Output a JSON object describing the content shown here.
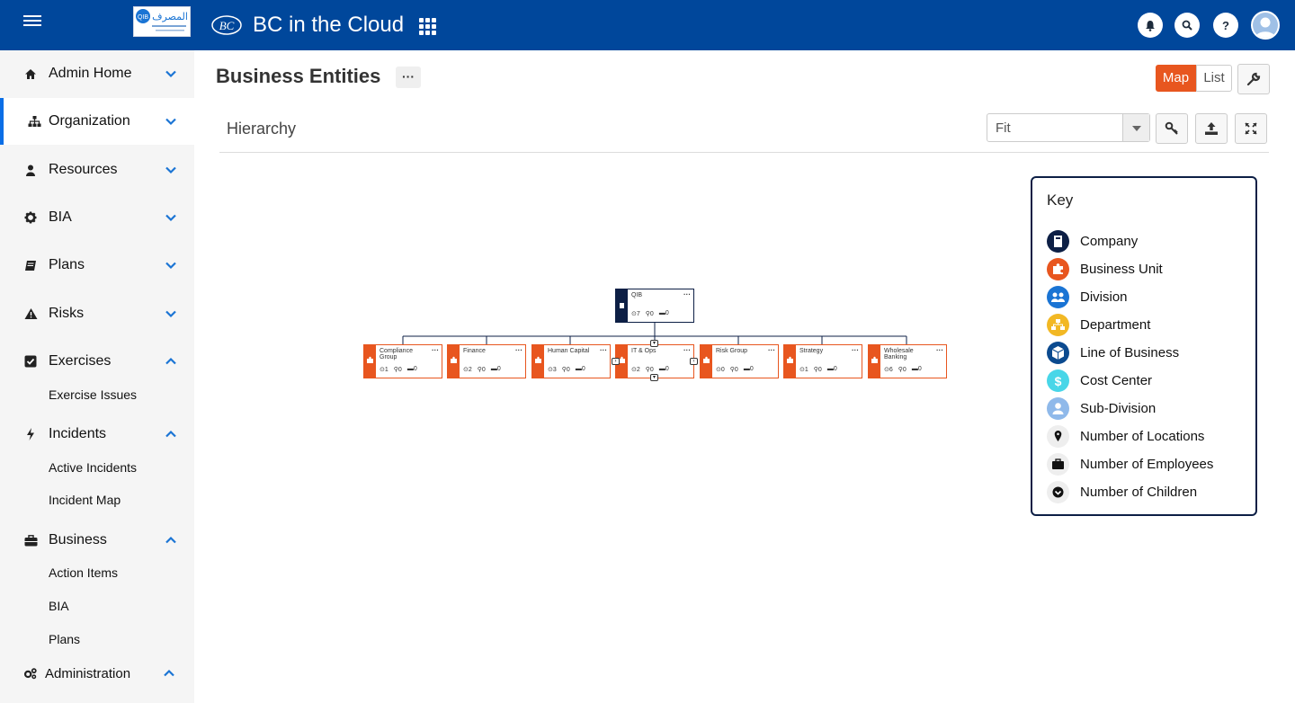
{
  "header": {
    "app_title": "BC in the Cloud",
    "logo_text": "المصرف",
    "logo_badge": "QIB",
    "app_badge": "BC",
    "help_label": "?"
  },
  "sidebar": {
    "items": [
      {
        "label": "Admin Home",
        "icon": "home-icon"
      },
      {
        "label": "Organization",
        "icon": "sitemap-icon"
      },
      {
        "label": "Resources",
        "icon": "user-icon"
      },
      {
        "label": "BIA",
        "icon": "gear-icon"
      },
      {
        "label": "Plans",
        "icon": "book-icon"
      },
      {
        "label": "Risks",
        "icon": "warning-icon"
      },
      {
        "label": "Exercises",
        "icon": "checkbox-icon",
        "sub": [
          "Exercise Issues"
        ]
      },
      {
        "label": "Incidents",
        "icon": "bolt-icon",
        "sub": [
          "Active Incidents",
          "Incident Map"
        ]
      },
      {
        "label": "Business",
        "icon": "briefcase-icon",
        "sub": [
          "Action Items",
          "BIA",
          "Plans"
        ]
      },
      {
        "label": "Administration",
        "icon": "cogs-icon"
      }
    ]
  },
  "main": {
    "title": "Business Entities",
    "more_label": "···",
    "view_toggle": {
      "map": "Map",
      "list": "List"
    },
    "section_label": "Hierarchy",
    "zoom_select": "Fit"
  },
  "org_chart": {
    "root": {
      "name": "QIB",
      "children": "7",
      "locations": "0",
      "employees": "0"
    },
    "children": [
      {
        "name": "Compliance Group",
        "children": "1",
        "locations": "0",
        "employees": "0"
      },
      {
        "name": "Finance",
        "children": "2",
        "locations": "0",
        "employees": "0"
      },
      {
        "name": "Human Capital",
        "children": "3",
        "locations": "0",
        "employees": "0"
      },
      {
        "name": "IT & Ops",
        "children": "2",
        "locations": "0",
        "employees": "0"
      },
      {
        "name": "Risk Group",
        "children": "0",
        "locations": "0",
        "employees": "0"
      },
      {
        "name": "Strategy",
        "children": "1",
        "locations": "0",
        "employees": "0"
      },
      {
        "name": "Wholesale Banking",
        "children": "6",
        "locations": "0",
        "employees": "0"
      }
    ]
  },
  "key": {
    "title": "Key",
    "items": [
      {
        "label": "Company",
        "color": "#0d1f45",
        "icon": "building-icon"
      },
      {
        "label": "Business Unit",
        "color": "#e8561f",
        "icon": "puzzle-icon"
      },
      {
        "label": "Division",
        "color": "#1a74d4",
        "icon": "users-icon"
      },
      {
        "label": "Department",
        "color": "#f2b824",
        "icon": "sitemap-icon"
      },
      {
        "label": "Line of Business",
        "color": "#0b4a8f",
        "icon": "cube-icon"
      },
      {
        "label": "Cost Center",
        "color": "#48d6e8",
        "icon": "dollar-icon"
      },
      {
        "label": "Sub-Division",
        "color": "#8fb9ea",
        "icon": "user-icon"
      },
      {
        "label": "Number of Locations",
        "color": "#eeeeee",
        "icon": "map-pin-icon"
      },
      {
        "label": "Number of Employees",
        "color": "#eeeeee",
        "icon": "briefcase-icon"
      },
      {
        "label": "Number of Children",
        "color": "#eeeeee",
        "icon": "chevron-circle-icon"
      }
    ]
  },
  "colors": {
    "header": "#00479b",
    "accent": "#e8561f",
    "active_border": "#0a6ee6"
  }
}
